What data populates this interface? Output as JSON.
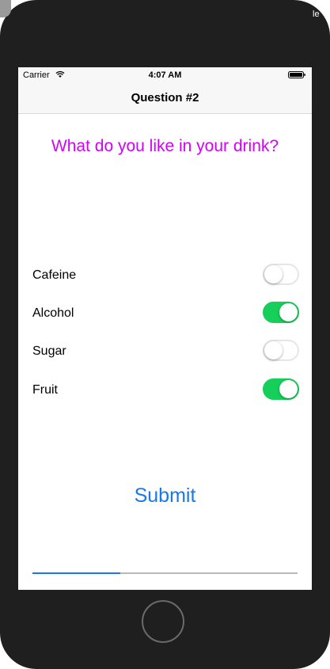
{
  "status_bar": {
    "carrier": "Carrier",
    "time": "4:07 AM"
  },
  "device": {
    "top_right_label": "le"
  },
  "nav": {
    "title": "Question #2"
  },
  "question": {
    "text": "What do you like in your drink?",
    "color": "#d400ff"
  },
  "options": [
    {
      "label": "Cafeine",
      "on": false
    },
    {
      "label": "Alcohol",
      "on": true
    },
    {
      "label": "Sugar",
      "on": false
    },
    {
      "label": "Fruit",
      "on": true
    }
  ],
  "submit": {
    "label": "Submit",
    "color": "#1a78e8"
  },
  "progress": {
    "fraction": 0.33
  },
  "colors": {
    "toggle_on": "#16cf5a",
    "accent": "#1a78e8"
  }
}
